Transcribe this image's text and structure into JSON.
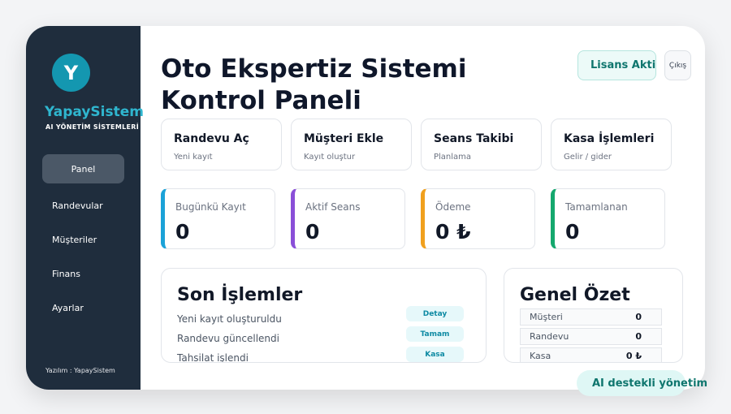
{
  "sidebar": {
    "logo_letter": "Y",
    "brand_name": "YapaySistem",
    "brand_subtitle": "AI YÖNETİM SİSTEMLERİ",
    "items": [
      {
        "label": "Panel",
        "active": true
      },
      {
        "label": "Randevular"
      },
      {
        "label": "Müşteriler"
      },
      {
        "label": "Finans"
      },
      {
        "label": "Ayarlar"
      }
    ],
    "footer": "Yazılım : YapaySistem"
  },
  "header": {
    "title_line1": "Oto Ekspertiz Sistemi",
    "title_line2": "Kontrol Paneli",
    "license_label": "Lisans Aktif",
    "exit_label": "Çıkış"
  },
  "actions": [
    {
      "title": "Randevu Aç",
      "subtitle": "Yeni kayıt"
    },
    {
      "title": "Müşteri Ekle",
      "subtitle": "Kayıt oluştur"
    },
    {
      "title": "Seans Takibi",
      "subtitle": "Planlama"
    },
    {
      "title": "Kasa İşlemleri",
      "subtitle": "Gelir / gider"
    }
  ],
  "stats": [
    {
      "label": "Bugünkü Kayıt",
      "value": "0",
      "color": "#1ba2d8"
    },
    {
      "label": "Aktif Seans",
      "value": "0",
      "color": "#8a4fd8"
    },
    {
      "label": "Ödeme",
      "value": "0 ₺",
      "color": "#f0a01e"
    },
    {
      "label": "Tamamlanan",
      "value": "0",
      "color": "#15a86e"
    }
  ],
  "recent": {
    "title": "Son İşlemler",
    "items": [
      {
        "text": "Yeni kayıt oluşturuldu",
        "badge": "Detay"
      },
      {
        "text": "Randevu güncellendi",
        "badge": "Tamam"
      },
      {
        "text": "Tahsilat işlendi",
        "badge": "Kasa"
      }
    ]
  },
  "summary": {
    "title": "Genel Özet",
    "rows": [
      {
        "label": "Müşteri",
        "value": "0"
      },
      {
        "label": "Randevu",
        "value": "0"
      },
      {
        "label": "Kasa",
        "value": "0 ₺"
      }
    ]
  },
  "footer_pill": "AI destekli yönetim"
}
